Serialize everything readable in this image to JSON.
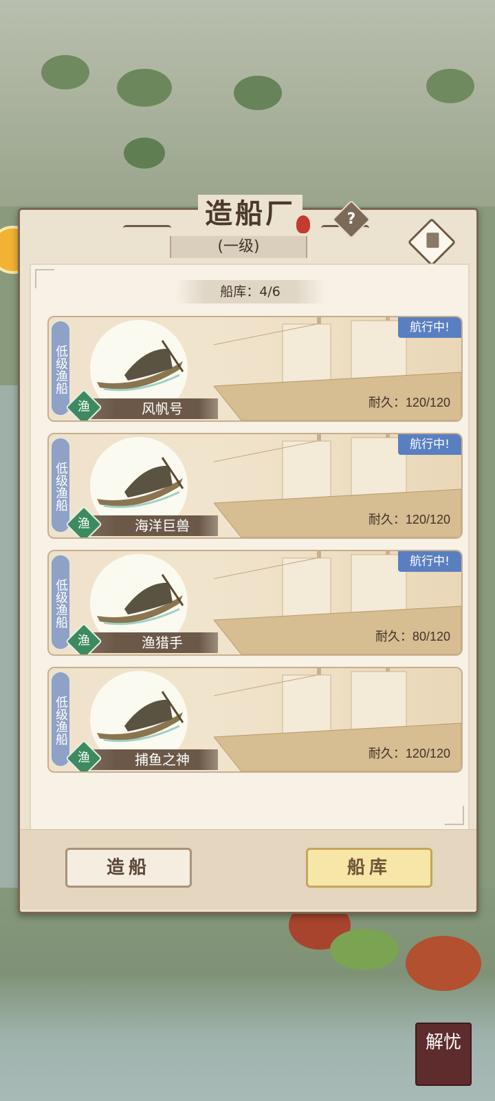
{
  "title": "造船厂",
  "level": "(一级)",
  "capacity": "船库：4/6",
  "help_icon": "?",
  "boats": [
    {
      "type": "低级渔船",
      "name": "风帆号",
      "category": "渔",
      "status": "航行中!",
      "durability": "耐久：120/120"
    },
    {
      "type": "低级渔船",
      "name": "海洋巨兽",
      "category": "渔",
      "status": "航行中!",
      "durability": "耐久：120/120"
    },
    {
      "type": "低级渔船",
      "name": "渔猎手",
      "category": "渔",
      "status": "航行中!",
      "durability": "耐久：80/120"
    },
    {
      "type": "低级渔船",
      "name": "捕鱼之神",
      "category": "渔",
      "status": "",
      "durability": "耐久：120/120"
    }
  ],
  "buttons": {
    "build": "造船",
    "dock": "船库"
  },
  "corner_badge": "解忧",
  "colors": {
    "status_blue": "#5a7fc0",
    "type_tag": "#8ea1c6",
    "fish_badge": "#3d8a60",
    "dock_button": "#f6e6a8"
  }
}
